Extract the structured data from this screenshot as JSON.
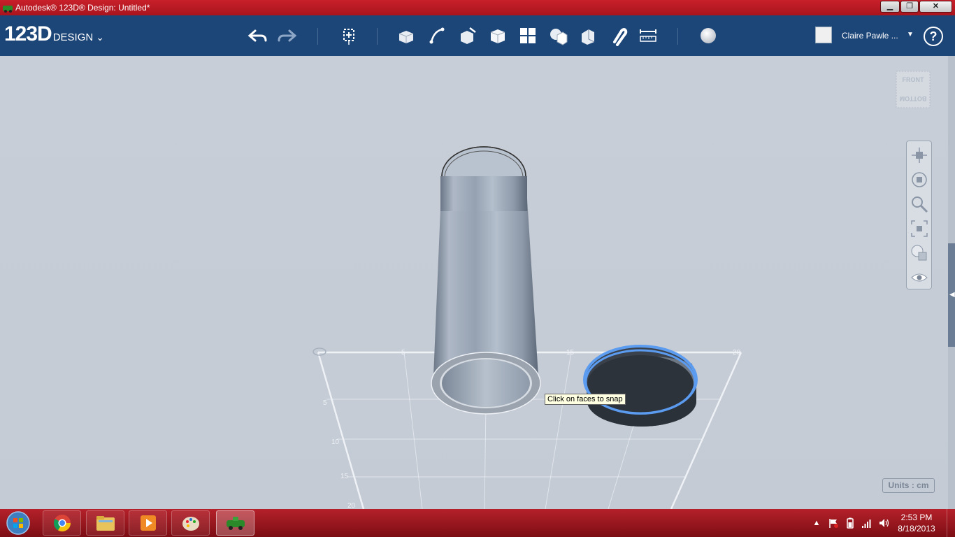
{
  "window": {
    "title": "Autodesk® 123D® Design: Untitled*",
    "minimize_glyph": "▁",
    "maximize_glyph": "❐",
    "close_glyph": "✕"
  },
  "toolbar": {
    "logo_main": "123D",
    "logo_sub": "DESIGN",
    "logo_menu_glyph": "⌄",
    "user_name": "Claire Pawle ...",
    "user_menu_glyph": "▼",
    "help_label": "?"
  },
  "viewport": {
    "viewcube_front": "FRONT",
    "viewcube_bottom": "BOTTOM",
    "grid_labels": [
      "5",
      "10",
      "15",
      "20"
    ],
    "grid_top_labels": [
      "5",
      "10",
      "15",
      "20"
    ],
    "tooltip": "Click on faces to snap",
    "units": "Units : cm"
  },
  "taskbar": {
    "clock_time": "2:53 PM",
    "clock_date": "8/18/2013",
    "tray_overflow_glyph": "▲"
  },
  "colors": {
    "titlebar": "#c8202a",
    "toolbar": "#1c4578",
    "viewport": "#c5ccd6",
    "selection_highlight": "#5b9bf0",
    "taskbar": "#9c1820"
  }
}
